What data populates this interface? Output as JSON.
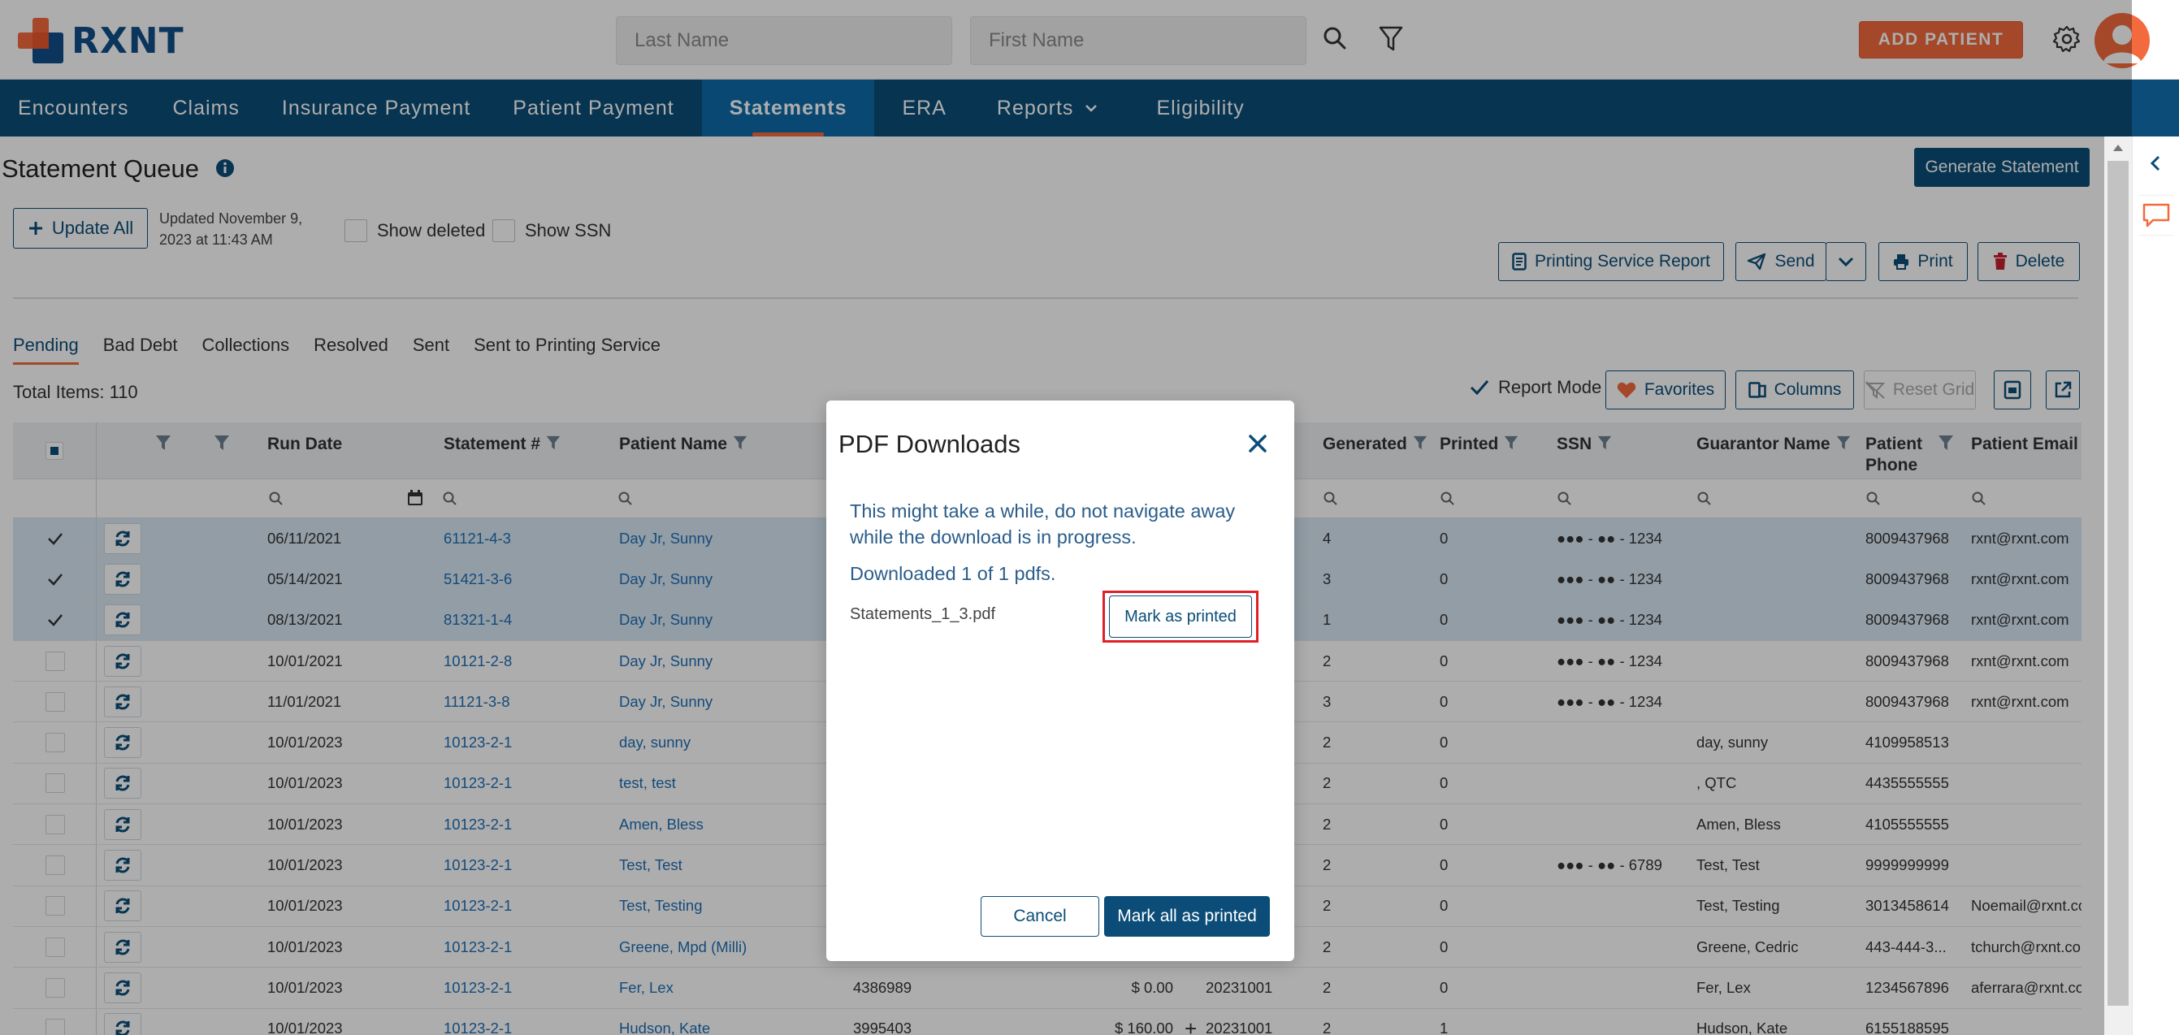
{
  "brand": {
    "logo_text": "RXNT",
    "accent": "#f26a3d",
    "primary": "#0b4d78"
  },
  "header": {
    "last_name_placeholder": "Last Name",
    "first_name_placeholder": "First Name",
    "add_patient_label": "ADD PATIENT"
  },
  "nav": {
    "items": [
      {
        "label": "Encounters"
      },
      {
        "label": "Claims"
      },
      {
        "label": "Insurance Payment"
      },
      {
        "label": "Patient Payment"
      },
      {
        "label": "Statements"
      },
      {
        "label": "ERA"
      },
      {
        "label": "Reports"
      },
      {
        "label": "Eligibility"
      }
    ],
    "active": "Statements"
  },
  "page": {
    "title": "Statement Queue",
    "generate_label": "Generate Statement",
    "update_all_label": "Update All",
    "updated_text": "Updated November 9, 2023 at 11:43 AM",
    "show_deleted_label": "Show deleted",
    "show_ssn_label": "Show SSN"
  },
  "toolbar": {
    "printing_service_report_label": "Printing Service Report",
    "send_label": "Send",
    "print_label": "Print",
    "delete_label": "Delete"
  },
  "tabs": [
    {
      "label": "Pending"
    },
    {
      "label": "Bad Debt"
    },
    {
      "label": "Collections"
    },
    {
      "label": "Resolved"
    },
    {
      "label": "Sent"
    },
    {
      "label": "Sent to Printing Service"
    }
  ],
  "grid_toolbar": {
    "total_items": "Total Items: 110",
    "report_mode_label": "Report Mode",
    "favorites_label": "Favorites",
    "columns_label": "Columns",
    "reset_grid_label": "Reset Grid"
  },
  "columns": {
    "run_date": "Run Date",
    "statement_no": "Statement #",
    "patient_name": "Patient Name",
    "generated": "Generated",
    "printed": "Printed",
    "ssn": "SSN",
    "guarantor_name": "Guarantor Name",
    "patient_phone": "Patient Phone",
    "patient_email": "Patient Email"
  },
  "rows": [
    {
      "selected": true,
      "run_date": "06/11/2021",
      "statement": "61121-4-3",
      "patient": "Day Jr, Sunny",
      "col4": "",
      "amount": "",
      "date2": "",
      "generated": "4",
      "printed": "0",
      "ssn": "●●● - ●● - 1234",
      "guarantor": "",
      "phone": "8009437968",
      "email": "rxnt@rxnt.com"
    },
    {
      "selected": true,
      "run_date": "05/14/2021",
      "statement": "51421-3-6",
      "patient": "Day Jr, Sunny",
      "col4": "",
      "amount": "",
      "date2": "",
      "generated": "3",
      "printed": "0",
      "ssn": "●●● - ●● - 1234",
      "guarantor": "",
      "phone": "8009437968",
      "email": "rxnt@rxnt.com"
    },
    {
      "selected": true,
      "run_date": "08/13/2021",
      "statement": "81321-1-4",
      "patient": "Day Jr, Sunny",
      "col4": "",
      "amount": "",
      "date2": "",
      "generated": "1",
      "printed": "0",
      "ssn": "●●● - ●● - 1234",
      "guarantor": "",
      "phone": "8009437968",
      "email": "rxnt@rxnt.com"
    },
    {
      "selected": false,
      "run_date": "10/01/2021",
      "statement": "10121-2-8",
      "patient": "Day Jr, Sunny",
      "col4": "",
      "amount": "",
      "date2": "",
      "generated": "2",
      "printed": "0",
      "ssn": "●●● - ●● - 1234",
      "guarantor": "",
      "phone": "8009437968",
      "email": "rxnt@rxnt.com"
    },
    {
      "selected": false,
      "run_date": "11/01/2021",
      "statement": "11121-3-8",
      "patient": "Day Jr, Sunny",
      "col4": "",
      "amount": "",
      "date2": "",
      "generated": "3",
      "printed": "0",
      "ssn": "●●● - ●● - 1234",
      "guarantor": "",
      "phone": "8009437968",
      "email": "rxnt@rxnt.com"
    },
    {
      "selected": false,
      "run_date": "10/01/2023",
      "statement": "10123-2-1",
      "patient": "day, sunny",
      "col4": "",
      "amount": "",
      "date2": "",
      "generated": "2",
      "printed": "0",
      "ssn": "",
      "guarantor": "day, sunny",
      "phone": "4109958513",
      "email": ""
    },
    {
      "selected": false,
      "run_date": "10/01/2023",
      "statement": "10123-2-1",
      "patient": "test, test",
      "col4": "",
      "amount": "",
      "date2": "",
      "generated": "2",
      "printed": "0",
      "ssn": "",
      "guarantor": ", QTC",
      "phone": "4435555555",
      "email": ""
    },
    {
      "selected": false,
      "run_date": "10/01/2023",
      "statement": "10123-2-1",
      "patient": "Amen, Bless",
      "col4": "",
      "amount": "",
      "date2": "",
      "generated": "2",
      "printed": "0",
      "ssn": "",
      "guarantor": "Amen, Bless",
      "phone": "4105555555",
      "email": ""
    },
    {
      "selected": false,
      "run_date": "10/01/2023",
      "statement": "10123-2-1",
      "patient": "Test, Test",
      "col4": "",
      "amount": "",
      "date2": "",
      "generated": "2",
      "printed": "0",
      "ssn": "●●● - ●● - 6789",
      "guarantor": "Test, Test",
      "phone": "9999999999",
      "email": ""
    },
    {
      "selected": false,
      "run_date": "10/01/2023",
      "statement": "10123-2-1",
      "patient": "Test, Testing",
      "col4": "",
      "amount": "",
      "date2": "",
      "generated": "2",
      "printed": "0",
      "ssn": "",
      "guarantor": "Test, Testing",
      "phone": "3013458614",
      "email": "Noemail@rxnt.co"
    },
    {
      "selected": false,
      "run_date": "10/01/2023",
      "statement": "10123-2-1",
      "patient": "Greene, Mpd (Milli)",
      "col4": "",
      "amount": "",
      "date2": "",
      "generated": "2",
      "printed": "0",
      "ssn": "",
      "guarantor": "Greene, Cedric",
      "phone": "443-444-3...",
      "email": "tchurch@rxnt.co"
    },
    {
      "selected": false,
      "run_date": "10/01/2023",
      "statement": "10123-2-1",
      "patient": "Fer, Lex",
      "col4": "4386989",
      "amount": "$ 0.00",
      "date2": "20231001",
      "generated": "2",
      "printed": "0",
      "ssn": "",
      "guarantor": "Fer, Lex",
      "phone": "1234567896",
      "email": "aferrara@rxnt.co"
    },
    {
      "selected": false,
      "run_date": "10/01/2023",
      "statement": "10123-2-1",
      "patient": "Hudson, Kate",
      "col4": "3995403",
      "amount": "$ 160.00",
      "date2": "20231001",
      "generated": "2",
      "printed": "1",
      "ssn": "",
      "guarantor": "Hudson, Kate",
      "phone": "6155188595",
      "email": ""
    }
  ],
  "modal": {
    "title": "PDF Downloads",
    "message": "This might take a while, do not navigate away while the download is in progress.",
    "count": "Downloaded 1 of 1 pdfs.",
    "file_name": "Statements_1_3.pdf",
    "mark_printed_label": "Mark as printed",
    "cancel_label": "Cancel",
    "mark_all_label": "Mark all as printed",
    "highlight_color": "#e11f26"
  }
}
